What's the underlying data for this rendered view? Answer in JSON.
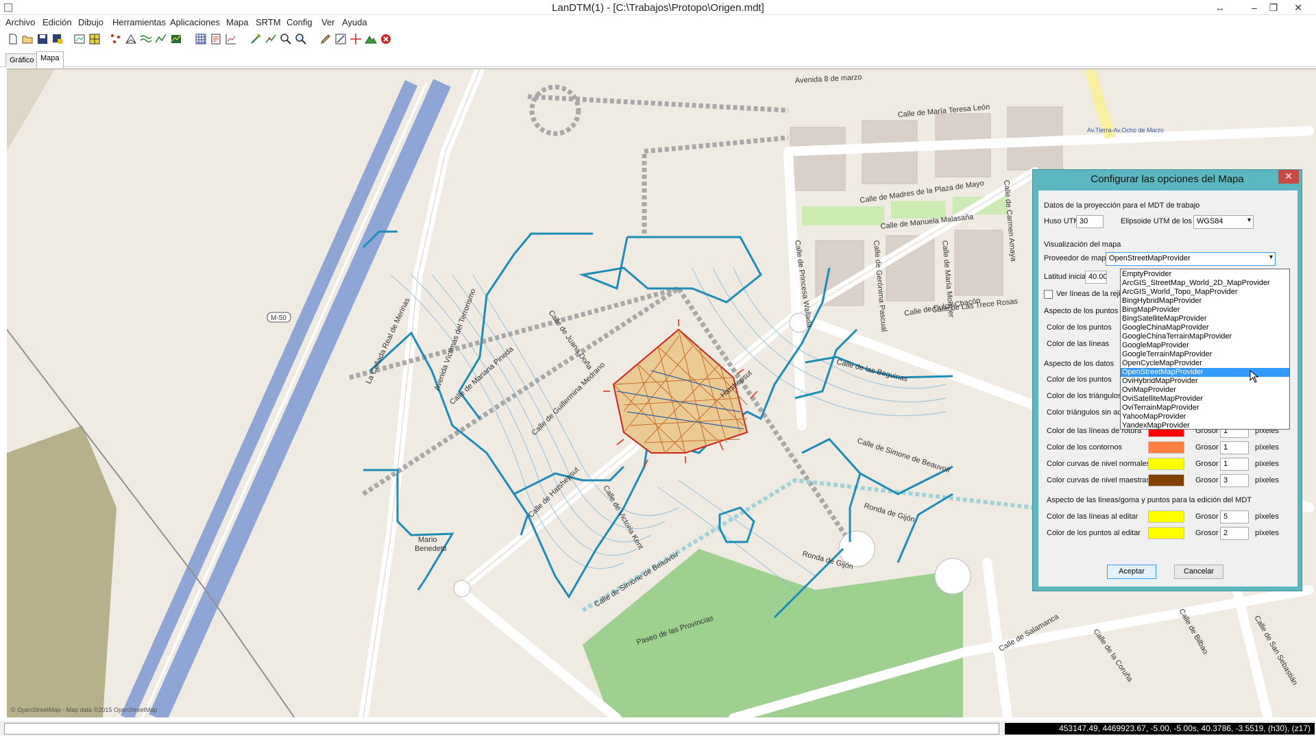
{
  "window": {
    "title": "LanDTM(1) - [C:\\Trabajos\\Protopo\\Origen.mdt]",
    "resize_glyph": "↔",
    "minimize_glyph": "–",
    "restore_glyph": "❐",
    "close_glyph": "✕"
  },
  "menu": [
    "Archivo",
    "Edición",
    "Dibujo",
    "Herramientas",
    "Aplicaciones",
    "Mapa",
    "SRTM",
    "Config",
    "Ver",
    "Ayuda"
  ],
  "toolbar": {
    "icons": [
      "new-file-icon",
      "open-folder-icon",
      "save-icon",
      "save-as-icon",
      "view-extent-icon",
      "raster-icon",
      "points-icon",
      "triangles-icon",
      "contours-icon",
      "profile-icon",
      "surface-icon",
      "grid-icon",
      "report-icon",
      "chart-icon",
      "draw-line-icon",
      "break-line-icon",
      "zoom-icon",
      "zoom-window-icon",
      "edit-icon",
      "measure-icon",
      "crosshair-icon",
      "terrain-icon",
      "stop-icon"
    ]
  },
  "tabs": [
    "Gráfico",
    "Mapa"
  ],
  "map": {
    "streets": [
      "Avenida 8 de marzo",
      "Calle de María Teresa León",
      "Calle de Madres de la Plaza de Mayo",
      "Calle de Manuela Malasaña",
      "Calle de Las Trece Rosas",
      "Calle de Carmen Amaya",
      "Calle de Gerónima Pascual",
      "Calle de Princesa Wallada",
      "Calle de María Molliner",
      "Calle de Dulce Chacón",
      "Calle de las Beguinas",
      "Calle de Simone de Beauvoir",
      "Ronda de Gijón",
      "Calle de Hatshepsut",
      "Calle de Victoria Kent",
      "Calle de Guillermina Medrano",
      "Calle de Mariana Pineda",
      "Calle de Juana Doña",
      "Avenida Víctimas del Terrorismo",
      "La Cañada Real de Merinas",
      "Paseo de las Provincias",
      "Calle de Salamanca",
      "Calle de Bilbao",
      "Calle de San Sebastián",
      "Calle de la Coruña",
      "Luna Lunera",
      "M-50",
      "Mario Benedetti",
      "Av.Tierra-Av.Ocho de Marzo"
    ],
    "attribution": "© OpenStreetMap - Map data ©2015 OpenStreetMap",
    "road_color": "#8ea6d6",
    "contour_color": "#1b8db8",
    "park_color": "#9ed08f"
  },
  "status": {
    "left": "",
    "coords": "453147.49, 4469923.67, -5.00, -5.00s, 40.3786, -3.5519, (h30), (z17)"
  },
  "dialog": {
    "title": "Configurar las opciones del Mapa",
    "close_glyph": "✕",
    "projection": {
      "group_label": "Datos de la proyección para el MDT de trabajo",
      "huso_label": "Huso UTM",
      "huso_value": "30",
      "elipsoide_label": "Elipsoide UTM de los datos",
      "elipsoide_value": "WGS84"
    },
    "visualization": {
      "group_label": "Visualización del mapa",
      "provider_label": "Proveedor de mapas",
      "provider_value": "OpenStreetMapProvider",
      "lat_label": "Latitud inicial",
      "lat_value": "40.00",
      "grid_label": "Ver líneas de la rejil"
    },
    "points_section": {
      "group_label": "Aspecto de los puntos",
      "color_points": "Color de los puntos",
      "color_lines": "Color de las líneas"
    },
    "data_section": {
      "group_label": "Aspecto de los datos",
      "color_points": "Color de los puntos",
      "color_triangles": "Color de los triángulos",
      "triangles_no": "Color triángulos sin ac",
      "rows": [
        {
          "label": "Color de las líneas de rotura",
          "color": "#ff0000",
          "grosor_label": "Grosor",
          "grosor": "1",
          "unit": "píxeles"
        },
        {
          "label": "Color de los contornos",
          "color": "#ff8040",
          "grosor_label": "Grosor",
          "grosor": "1",
          "unit": "píxeles"
        },
        {
          "label": "Color curvas de nivel normales",
          "color": "#ffff00",
          "grosor_label": "Grosor",
          "grosor": "1",
          "unit": "píxeles"
        },
        {
          "label": "Color curvas de nivel maestras",
          "color": "#804000",
          "grosor_label": "Grosor",
          "grosor": "3",
          "unit": "píxeles"
        }
      ]
    },
    "edit_section": {
      "group_label": "Aspecto de las líneas/goma y puntos para la edición del MDT",
      "rows": [
        {
          "label": "Color de las líneas al editar",
          "color": "#ffff00",
          "grosor_label": "Grosor",
          "grosor": "5",
          "unit": "píxeles"
        },
        {
          "label": "Color de los puntos al editar",
          "color": "#ffff00",
          "grosor_label": "Grosor",
          "grosor": "2",
          "unit": "píxeles"
        }
      ]
    },
    "buttons": {
      "ok": "Aceptar",
      "cancel": "Cancelar"
    },
    "provider_options": [
      "EmptyProvider",
      "ArcGIS_StreetMap_World_2D_MapProvider",
      "ArcGIS_World_Topo_MapProvider",
      "BingHybridMapProvider",
      "BingMapProvider",
      "BingSatelliteMapProvider",
      "GoogleChinaMapProvider",
      "GoogleChinaTerrainMapProvider",
      "GoogleMapProvider",
      "GoogleTerrainMapProvider",
      "OpenCycleMapProvider",
      "OpenStreetMapProvider",
      "OviHybridMapProvider",
      "OviMapProvider",
      "OviSatelliteMapProvider",
      "OviTerrainMapProvider",
      "YahooMapProvider",
      "YandexMapProvider"
    ],
    "provider_selected_index": 11
  }
}
